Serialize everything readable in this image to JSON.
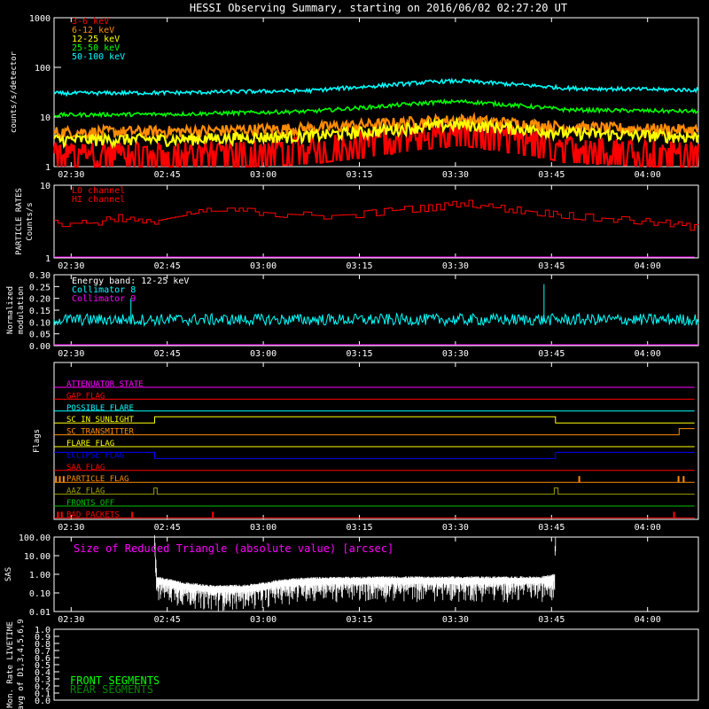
{
  "title": "HESSI Observing Summary, starting on 2016/06/02 02:27:20 UT",
  "time_labels": [
    "02:30",
    "02:45",
    "03:00",
    "03:15",
    "03:30",
    "03:45",
    "04:00"
  ],
  "time_label_minutes": [
    2.67,
    17.67,
    32.67,
    47.67,
    62.67,
    77.67,
    92.67
  ],
  "time_range_minutes": [
    0,
    100.6
  ],
  "colors": {
    "axis": "#ffffff",
    "band_3_6": "#ff0000",
    "band_6_12": "#ff8c00",
    "band_12_25": "#ffff00",
    "band_25_50": "#00ff00",
    "band_50_100": "#00ffff",
    "magenta": "#ff00ff",
    "blue": "#0000ff",
    "olive": "#a0a000",
    "green": "#00c000"
  },
  "chart_data": [
    {
      "type": "line",
      "name": "count-rates",
      "ylabel": "counts/s/detector",
      "yscale": "log",
      "ylim": [
        1,
        1000
      ],
      "ytick_labels": [
        "1",
        "10",
        "100",
        "1000"
      ],
      "legend": [
        "3-6 keV",
        "6-12 keV",
        "12-25 keV",
        "25-50 keV",
        "50-100 keV"
      ],
      "legend_position": "top-left",
      "series": [
        {
          "name": "3-6 keV",
          "color_key": "band_3_6",
          "x": [
            0,
            20,
            40,
            50,
            60,
            64,
            70,
            80,
            100
          ],
          "y": [
            2.2,
            2.2,
            2.8,
            4,
            6,
            6.5,
            5,
            3,
            2.3
          ]
        },
        {
          "name": "6-12 keV",
          "color_key": "band_6_12",
          "x": [
            0,
            20,
            40,
            50,
            60,
            64,
            70,
            80,
            100
          ],
          "y": [
            5,
            5.2,
            6,
            7.2,
            8.5,
            8.8,
            7.8,
            6.3,
            5.5
          ]
        },
        {
          "name": "12-25 keV",
          "color_key": "band_12_25",
          "x": [
            0,
            20,
            40,
            50,
            60,
            64,
            70,
            80,
            100
          ],
          "y": [
            3.5,
            3.6,
            4.2,
            5.2,
            6.8,
            7,
            6.2,
            4.8,
            4
          ]
        },
        {
          "name": "25-50 keV",
          "color_key": "band_25_50",
          "x": [
            0,
            20,
            40,
            50,
            60,
            64,
            70,
            80,
            100
          ],
          "y": [
            11,
            11.5,
            13,
            16,
            20,
            20.5,
            18,
            14,
            13
          ]
        },
        {
          "name": "50-100 keV",
          "color_key": "band_50_100",
          "x": [
            0,
            20,
            40,
            50,
            60,
            64,
            70,
            80,
            100
          ],
          "y": [
            30,
            31,
            34,
            42,
            52,
            53,
            47,
            38,
            35
          ]
        }
      ]
    },
    {
      "type": "line",
      "name": "particle-rates",
      "ylabel": [
        "PARTICLE RATES",
        "Counts/s"
      ],
      "yscale": "log",
      "ylim": [
        1,
        10
      ],
      "ytick_labels": [
        "1",
        "10"
      ],
      "legend": [
        "LO channel",
        "HI channel"
      ],
      "series": [
        {
          "name": "LO channel",
          "color_key": "band_3_6",
          "step": true,
          "x": [
            0,
            2,
            6,
            10,
            14,
            20,
            24,
            30,
            36,
            42,
            48,
            54,
            60,
            64,
            68,
            72,
            78,
            84,
            90,
            96,
            100
          ],
          "y": [
            3,
            3,
            3,
            3.6,
            3,
            3.8,
            4.4,
            4.4,
            4,
            3.8,
            4,
            4.6,
            5,
            5.8,
            5,
            4.6,
            4,
            3.6,
            3.3,
            3,
            2.6
          ]
        },
        {
          "name": "HI channel",
          "color_key": "magenta",
          "x": [
            0,
            100
          ],
          "y": [
            1,
            1
          ]
        }
      ]
    },
    {
      "type": "line",
      "name": "modulation",
      "ylabel": [
        "Normalized",
        "modulation"
      ],
      "ylim": [
        0,
        0.3
      ],
      "ytick_labels": [
        "0.00",
        "0.05",
        "0.10",
        "0.15",
        "0.20",
        "0.25",
        "0.30"
      ],
      "legend": [
        "Energy band: 12-25 keV",
        "Collimator 8",
        "Collimator 9"
      ],
      "series": [
        {
          "name": "Collimator 8",
          "color_key": "band_50_100",
          "x": [
            0,
            100
          ],
          "y": [
            0.11,
            0.11
          ],
          "spikes": {
            "x": [
              12,
              76.5
            ],
            "y": [
              0.2,
              0.26
            ]
          }
        },
        {
          "name": "Collimator 9",
          "color_key": "magenta",
          "x": [
            0,
            100
          ],
          "y": [
            0,
            0
          ]
        }
      ]
    },
    {
      "type": "line",
      "name": "flags",
      "ylabel": "Flags",
      "flags": [
        {
          "name": "ATTENUATOR STATE",
          "color_key": "magenta",
          "x": [
            0,
            100
          ],
          "y": [
            0,
            0
          ]
        },
        {
          "name": "GAP FLAG",
          "color_key": "band_3_6",
          "x": [
            0,
            100
          ],
          "y": [
            0,
            0
          ]
        },
        {
          "name": "POSSIBLE FLARE",
          "color_key": "band_50_100",
          "x": [
            0,
            100
          ],
          "y": [
            0,
            0
          ]
        },
        {
          "name": "SC IN SUNLIGHT",
          "color_key": "band_12_25",
          "x": [
            0,
            15.7,
            15.7,
            78.3,
            78.3,
            100
          ],
          "y": [
            0,
            0,
            1,
            1,
            0,
            0
          ]
        },
        {
          "name": "SC TRANSMITTER",
          "color_key": "band_6_12",
          "x": [
            0,
            97.6,
            97.6,
            100
          ],
          "y": [
            0,
            0,
            1,
            1
          ]
        },
        {
          "name": "FLARE FLAG",
          "color_key": "band_12_25",
          "x": [
            0,
            100
          ],
          "y": [
            0,
            0
          ]
        },
        {
          "name": "ECLIPSE FLAG",
          "color_key": "blue",
          "x": [
            0,
            15.7,
            15.7,
            78.3,
            78.3,
            100
          ],
          "y": [
            1,
            1,
            0,
            0,
            1,
            1
          ]
        },
        {
          "name": "SAA FLAG",
          "color_key": "band_3_6",
          "x": [
            0,
            100
          ],
          "y": [
            0,
            0
          ]
        },
        {
          "name": "PARTICLE FLAG",
          "color_key": "band_6_12",
          "x": [
            0,
            100
          ],
          "y": [
            0,
            0
          ],
          "spikes_x": [
            0.3,
            0.9,
            1.5,
            82,
            97.5,
            98.3
          ]
        },
        {
          "name": "AAZ FLAG",
          "color_key": "olive",
          "x": [
            0,
            15.6,
            15.6,
            16.1,
            16.1,
            78.1,
            78.1,
            78.7,
            78.7,
            100
          ],
          "y": [
            0,
            0,
            1,
            1,
            0,
            0,
            1,
            1,
            0,
            0
          ]
        },
        {
          "name": "FRONTS OFF",
          "color_key": "green",
          "x": [
            0,
            100
          ],
          "y": [
            0,
            0
          ]
        },
        {
          "name": "BAD PACKETS",
          "color_key": "band_3_6",
          "x": [
            0,
            100
          ],
          "y": [
            0,
            0
          ],
          "spikes_x": [
            0.6,
            1.2,
            12.2,
            24.8,
            96.8
          ]
        }
      ]
    },
    {
      "type": "line",
      "name": "sas",
      "ylabel": "SAS",
      "yscale": "log",
      "ylim": [
        0.01,
        100
      ],
      "ytick_labels": [
        "0.01",
        "0.10",
        "1.00",
        "10.00",
        "100.00"
      ],
      "annotation": "Size of Reduced Triangle (absolute value) [arcsec]",
      "series": [
        {
          "name": "SAS triangle",
          "color_key": "axis",
          "x": [
            15.7,
            15.8,
            16,
            20,
            25,
            30,
            33,
            36,
            40,
            50,
            60,
            70,
            76,
            78.2,
            78.3
          ],
          "y": [
            100,
            10,
            0.6,
            0.3,
            0.2,
            0.22,
            0.3,
            0.45,
            0.55,
            0.6,
            0.6,
            0.6,
            0.6,
            0.8,
            100
          ]
        }
      ]
    },
    {
      "type": "line",
      "name": "livetime",
      "ylabel": [
        "Mon. Rate LIVETIME",
        "avg of D1,3,4,5,6,9"
      ],
      "ylim": [
        0,
        1
      ],
      "ytick_labels": [
        "0.0",
        "0.1",
        "0.2",
        "0.3",
        "0.4",
        "0.5",
        "0.6",
        "0.7",
        "0.8",
        "0.9",
        "1.0"
      ],
      "legend": [
        "FRONT SEGMENTS",
        "REAR SEGMENTS"
      ],
      "series": []
    }
  ]
}
